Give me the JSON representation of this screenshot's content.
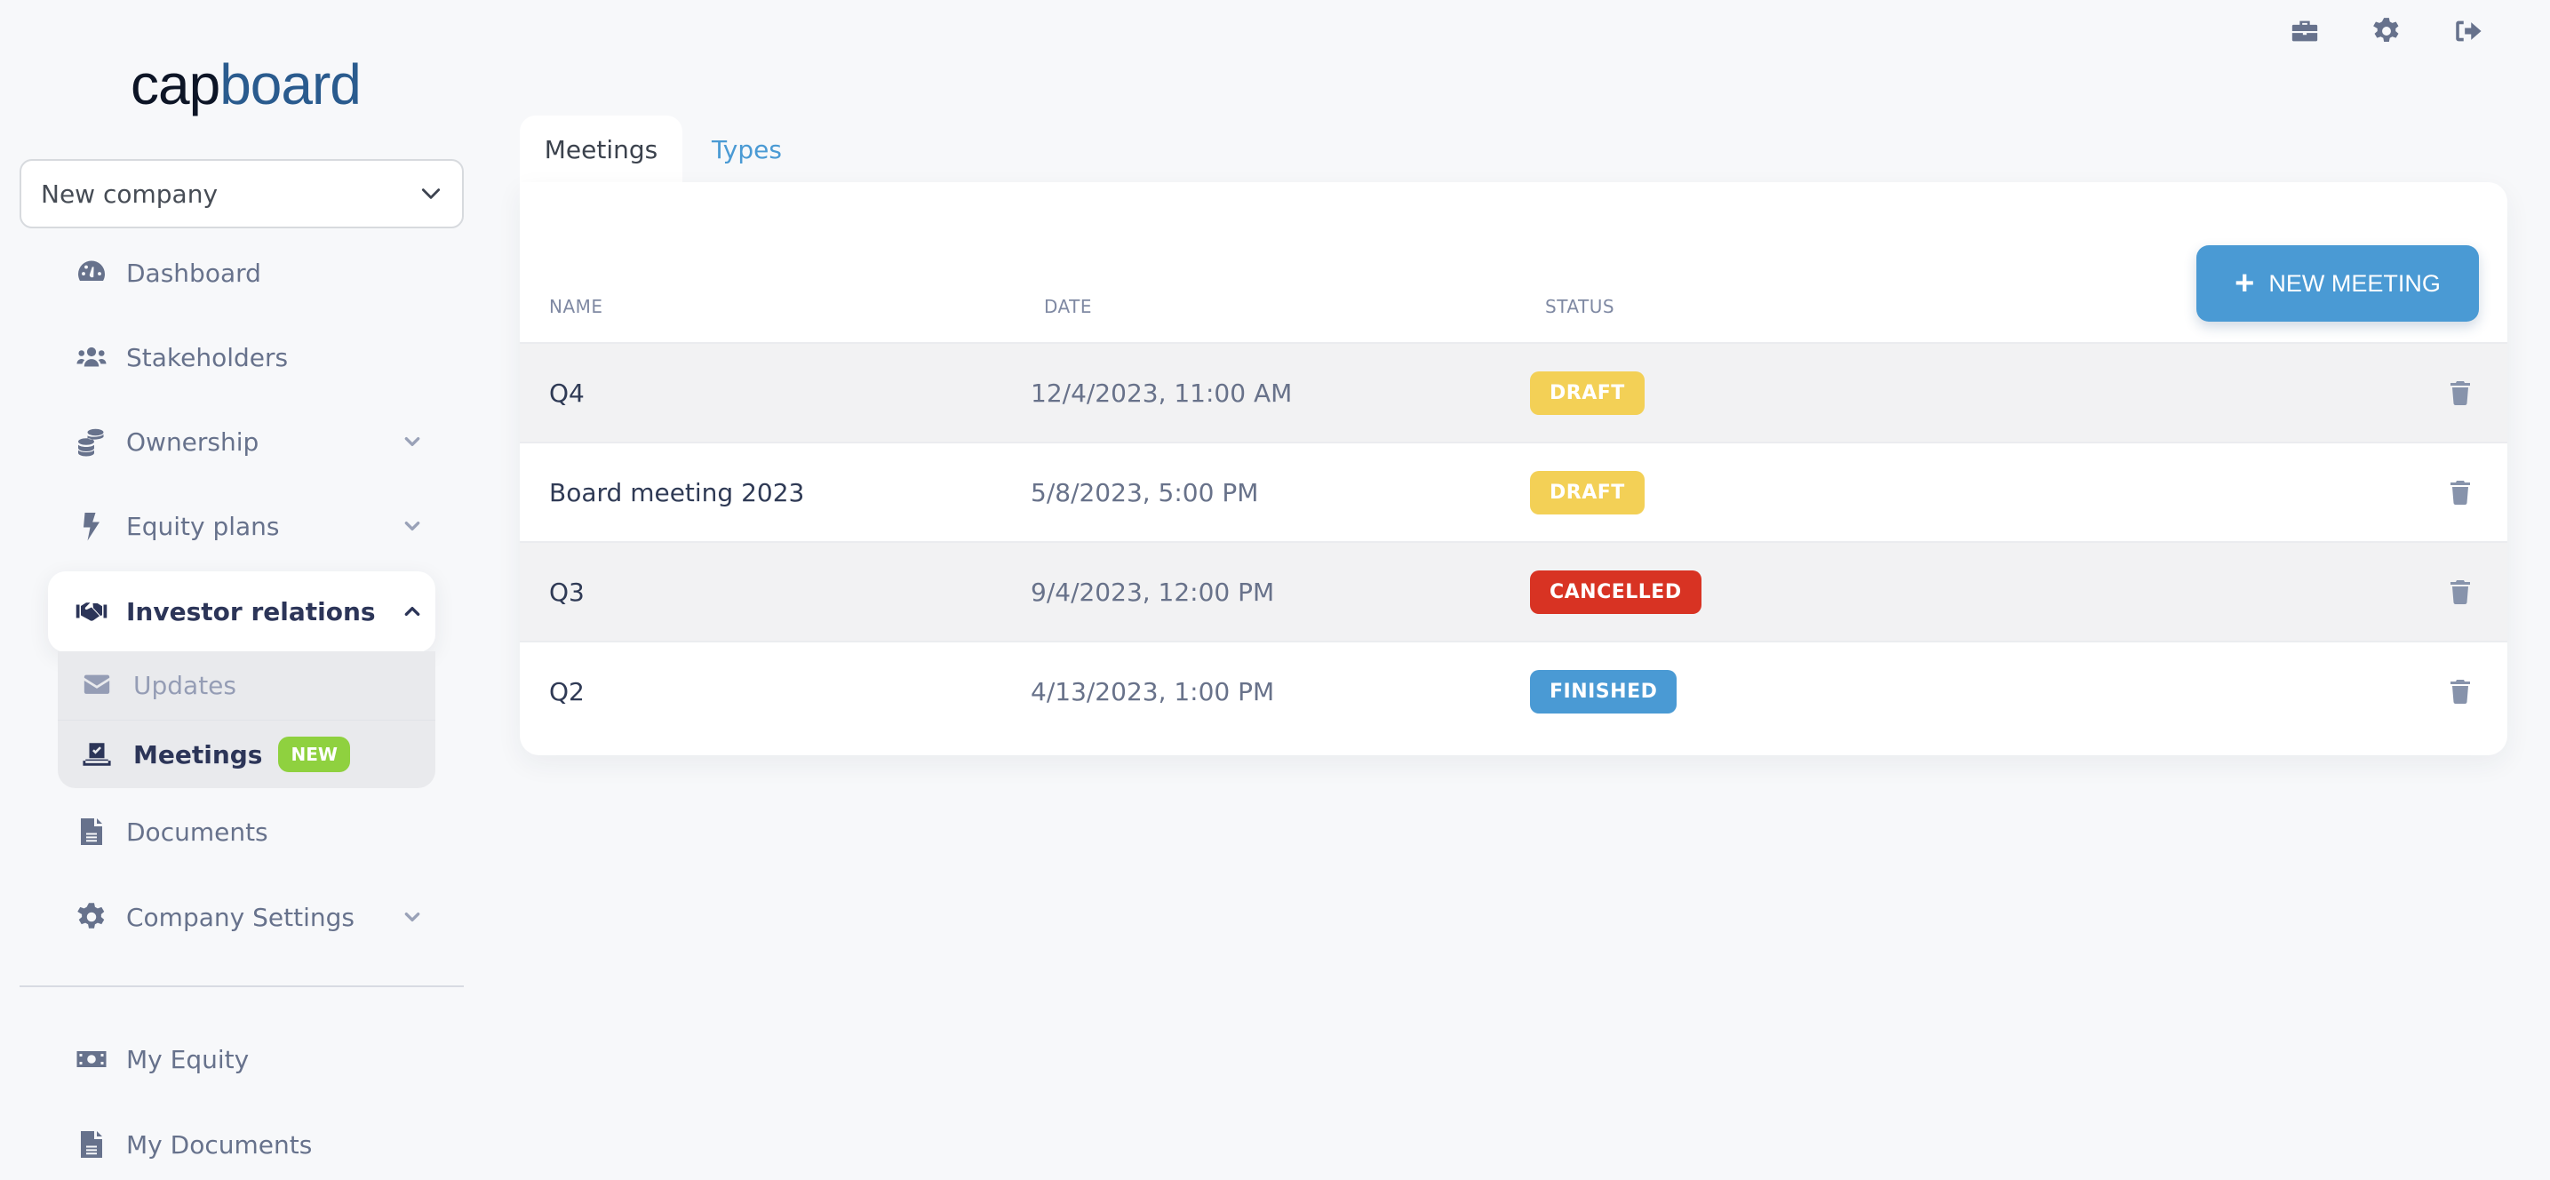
{
  "brand": {
    "part1": "cap",
    "part2": "board"
  },
  "company_select": {
    "value": "New company"
  },
  "sidebar": {
    "items": [
      {
        "label": "Dashboard",
        "icon": "gauge-icon"
      },
      {
        "label": "Stakeholders",
        "icon": "users-icon"
      },
      {
        "label": "Ownership",
        "icon": "coins-icon",
        "expandable": true
      },
      {
        "label": "Equity plans",
        "icon": "bolt-icon",
        "expandable": true
      },
      {
        "label": "Investor relations",
        "icon": "handshake-icon",
        "expanded": true
      },
      {
        "label": "Documents",
        "icon": "file-icon"
      },
      {
        "label": "Company Settings",
        "icon": "gear-icon",
        "expandable": true
      }
    ],
    "submenu": [
      {
        "label": "Updates",
        "icon": "envelope-icon"
      },
      {
        "label": "Meetings",
        "icon": "vote-icon",
        "badge": "NEW",
        "active": true
      }
    ],
    "personal": [
      {
        "label": "My Equity",
        "icon": "money-bill-icon"
      },
      {
        "label": "My Documents",
        "icon": "file-icon"
      }
    ]
  },
  "top_icons": [
    "briefcase-icon",
    "gear-icon",
    "sign-out-icon"
  ],
  "tabs": [
    {
      "label": "Meetings",
      "active": true
    },
    {
      "label": "Types",
      "active": false
    }
  ],
  "table": {
    "columns": [
      "NAME",
      "DATE",
      "STATUS"
    ],
    "new_button": "NEW MEETING",
    "rows": [
      {
        "name": "Q4",
        "date": "12/4/2023, 11:00 AM",
        "status": "DRAFT",
        "status_color": "#f3d056"
      },
      {
        "name": "Board meeting 2023",
        "date": "5/8/2023, 5:00 PM",
        "status": "DRAFT",
        "status_color": "#f3d056"
      },
      {
        "name": "Q3",
        "date": "9/4/2023, 12:00 PM",
        "status": "CANCELLED",
        "status_color": "#d83323"
      },
      {
        "name": "Q2",
        "date": "4/13/2023, 1:00 PM",
        "status": "FINISHED",
        "status_color": "#4a9ad4"
      }
    ]
  },
  "colors": {
    "accent": "#4a9ad4",
    "new_badge": "#8fd13f",
    "brand_dark": "#0d1526",
    "brand_blue": "#2a5b8e"
  }
}
